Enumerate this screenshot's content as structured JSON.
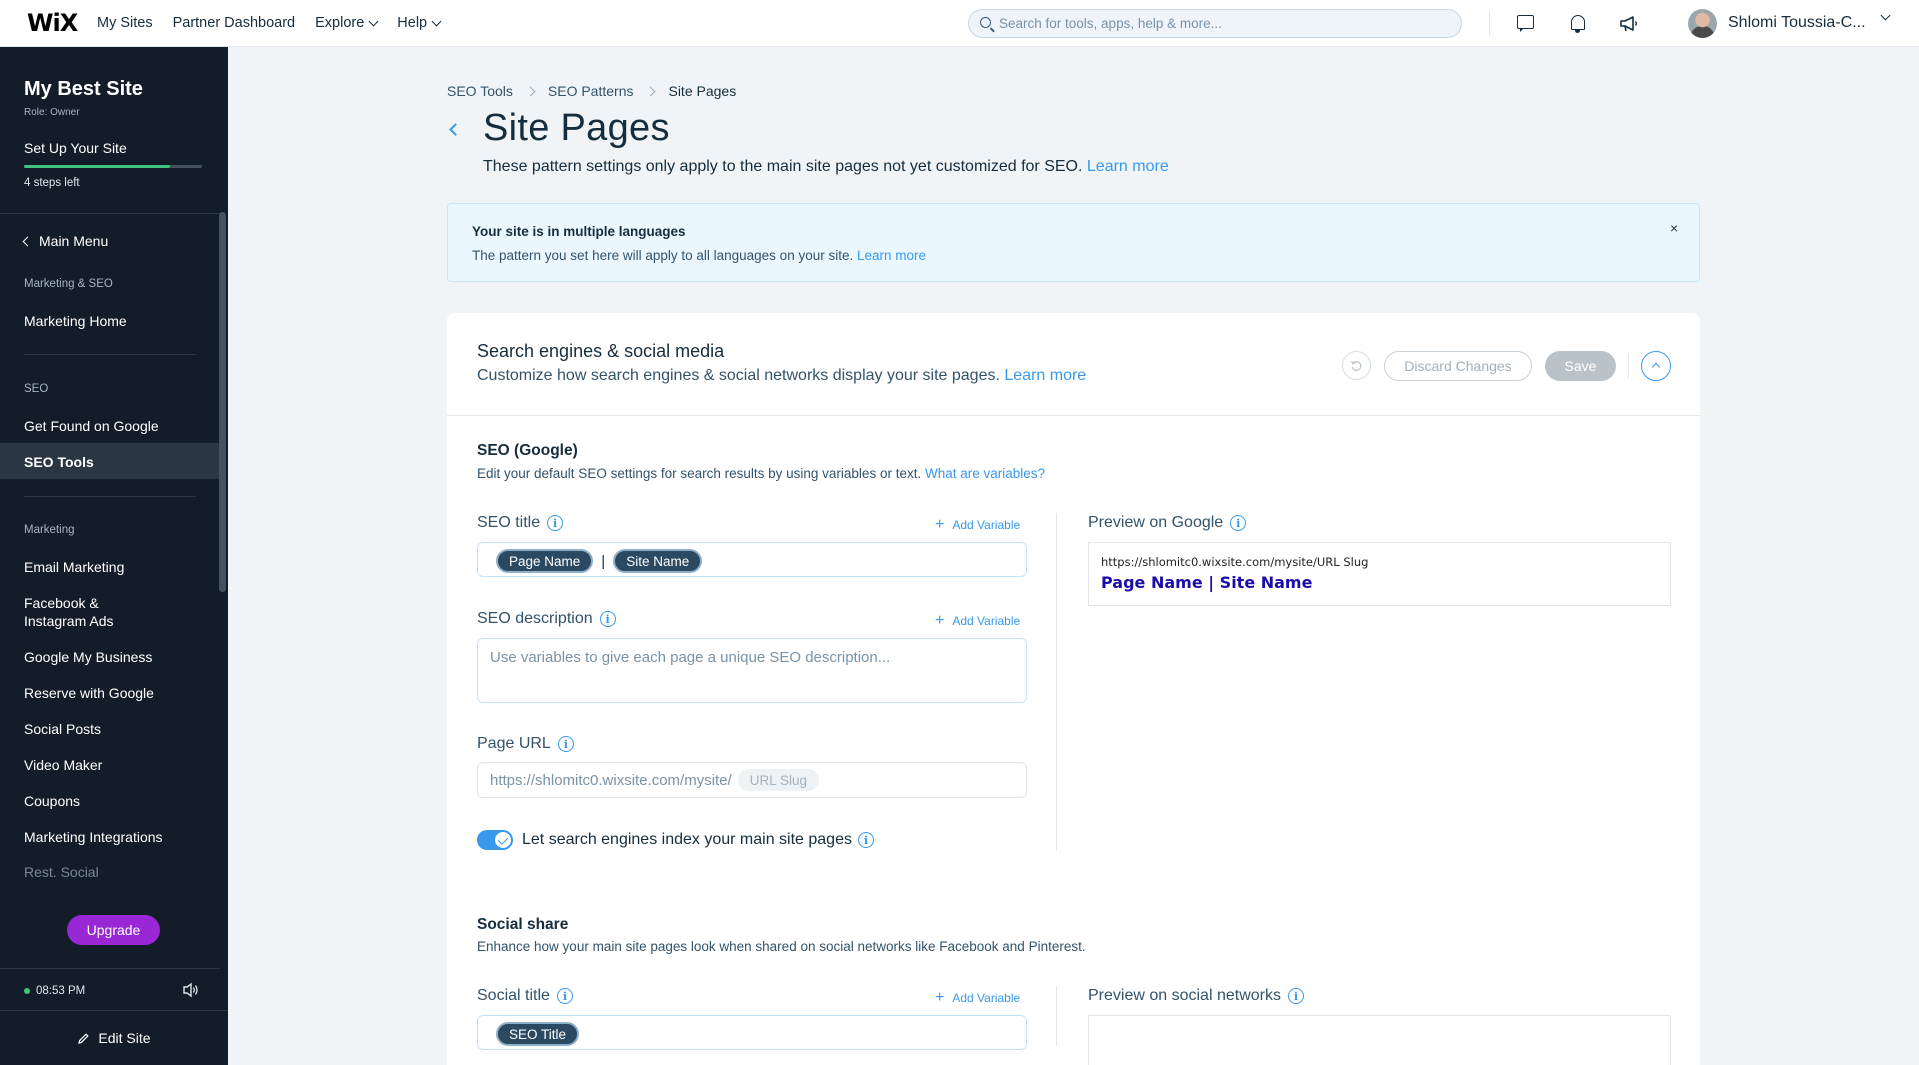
{
  "topbar": {
    "logo": "WiX",
    "nav": [
      "My Sites",
      "Partner Dashboard",
      "Explore",
      "Help"
    ],
    "search_placeholder": "Search for tools, apps, help & more...",
    "user_name": "Shlomi Toussia-C..."
  },
  "sidebar": {
    "site_name": "My Best Site",
    "role": "Role: Owner",
    "setup_label": "Set Up Your Site",
    "setup_progress": 0.82,
    "steps_left": "4 steps left",
    "main_menu": "Main Menu",
    "sections": [
      {
        "label": "Marketing & SEO",
        "items": [
          "Marketing Home"
        ]
      },
      {
        "label": "SEO",
        "items": [
          "Get Found on Google",
          "SEO Tools"
        ]
      },
      {
        "label": "Marketing",
        "items": [
          "Email Marketing",
          "Facebook & Instagram Ads",
          "Google My Business",
          "Reserve with Google",
          "Social Posts",
          "Video Maker",
          "Coupons",
          "Marketing Integrations",
          "Rest. Social"
        ]
      }
    ],
    "item_facebook_line1": "Facebook &",
    "item_facebook_line2": "Instagram Ads",
    "upgrade": "Upgrade",
    "time": "08:53 PM",
    "edit_site": "Edit Site"
  },
  "breadcrumb": [
    "SEO Tools",
    "SEO Patterns",
    "Site Pages"
  ],
  "page": {
    "title": "Site Pages",
    "subtitle": "These pattern settings only apply to the main site pages not yet customized for SEO.",
    "learn_more": "Learn more"
  },
  "notice": {
    "title": "Your site is in multiple languages",
    "text": "The pattern you set here will apply to all languages on your site.",
    "learn_more": "Learn more",
    "close": "×"
  },
  "card": {
    "title": "Search engines & social media",
    "subtitle": "Customize how search engines & social networks display your site pages.",
    "learn_more": "Learn more",
    "discard": "Discard Changes",
    "save": "Save"
  },
  "seo": {
    "title": "SEO (Google)",
    "subtitle": "Edit your default SEO settings for search results by using variables or text.",
    "variables_link": "What are variables?",
    "seo_title_label": "SEO title",
    "add_variable": "Add Variable",
    "title_tags": [
      "Page Name",
      "Site Name"
    ],
    "separator": "|",
    "desc_label": "SEO description",
    "desc_placeholder": "Use variables to give each page a unique SEO description...",
    "url_label": "Page URL",
    "url_prefix": "https://shlomitc0.wixsite.com/mysite/",
    "url_slug": "URL Slug",
    "index_label": "Let search engines index your main site pages",
    "index_on": true,
    "preview_label": "Preview on Google",
    "preview_url": "https://shlomitc0.wixsite.com/mysite/URL Slug",
    "preview_title": "Page Name | Site Name"
  },
  "social": {
    "title": "Social share",
    "subtitle": "Enhance how your main site pages look when shared on social networks like Facebook and Pinterest.",
    "title_label": "Social title",
    "add_variable": "Add Variable",
    "title_tag": "SEO Title",
    "preview_label": "Preview on social networks"
  },
  "colors": {
    "accent": "#3899ec",
    "sidebar_bg": "#131d29",
    "upgrade": "#9a27d5",
    "progress": "#3fc47e"
  }
}
